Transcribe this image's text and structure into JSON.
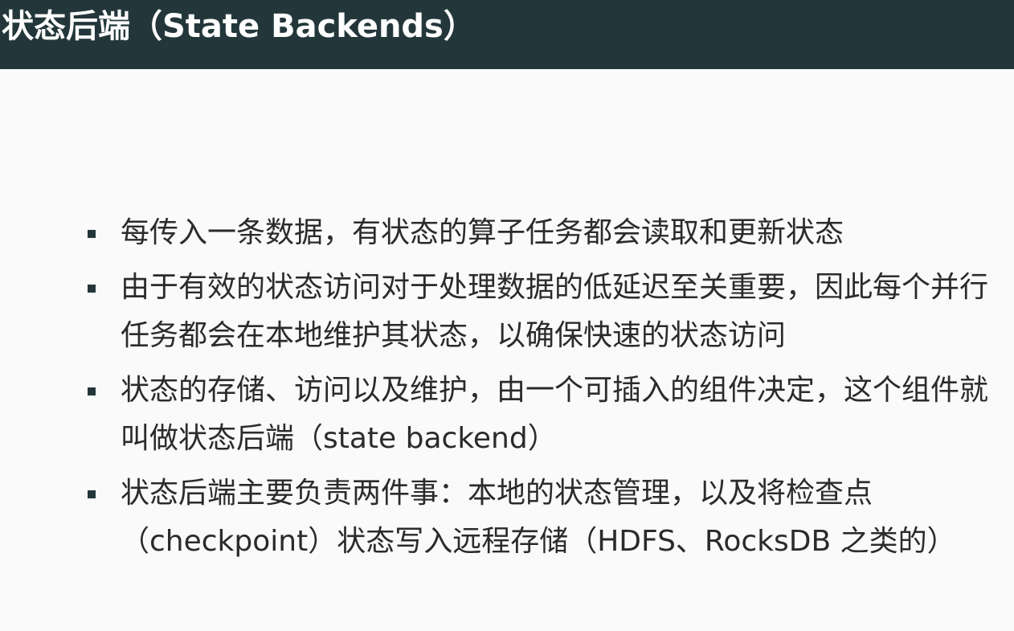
{
  "slide": {
    "title": "状态后端（State Backends）"
  },
  "bullets": [
    "每传入一条数据，有状态的算子任务都会读取和更新状态",
    "由于有效的状态访问对于处理数据的低延迟至关重要，因此每个并行任务都会在本地维护其状态，以确保快速的状态访问",
    "状态的存储、访问以及维护，由一个可插入的组件决定，这个组件就叫做状态后端（state backend）",
    "状态后端主要负责两件事：本地的状态管理，以及将检查点（checkpoint）状态写入远程存储（HDFS、RocksDB 之类的）"
  ],
  "colors": {
    "title_bar": "#23373b",
    "title_text": "#ffffff",
    "background": "#fafafa",
    "body_text": "#2b2b2b",
    "bullet": "#23373b"
  }
}
